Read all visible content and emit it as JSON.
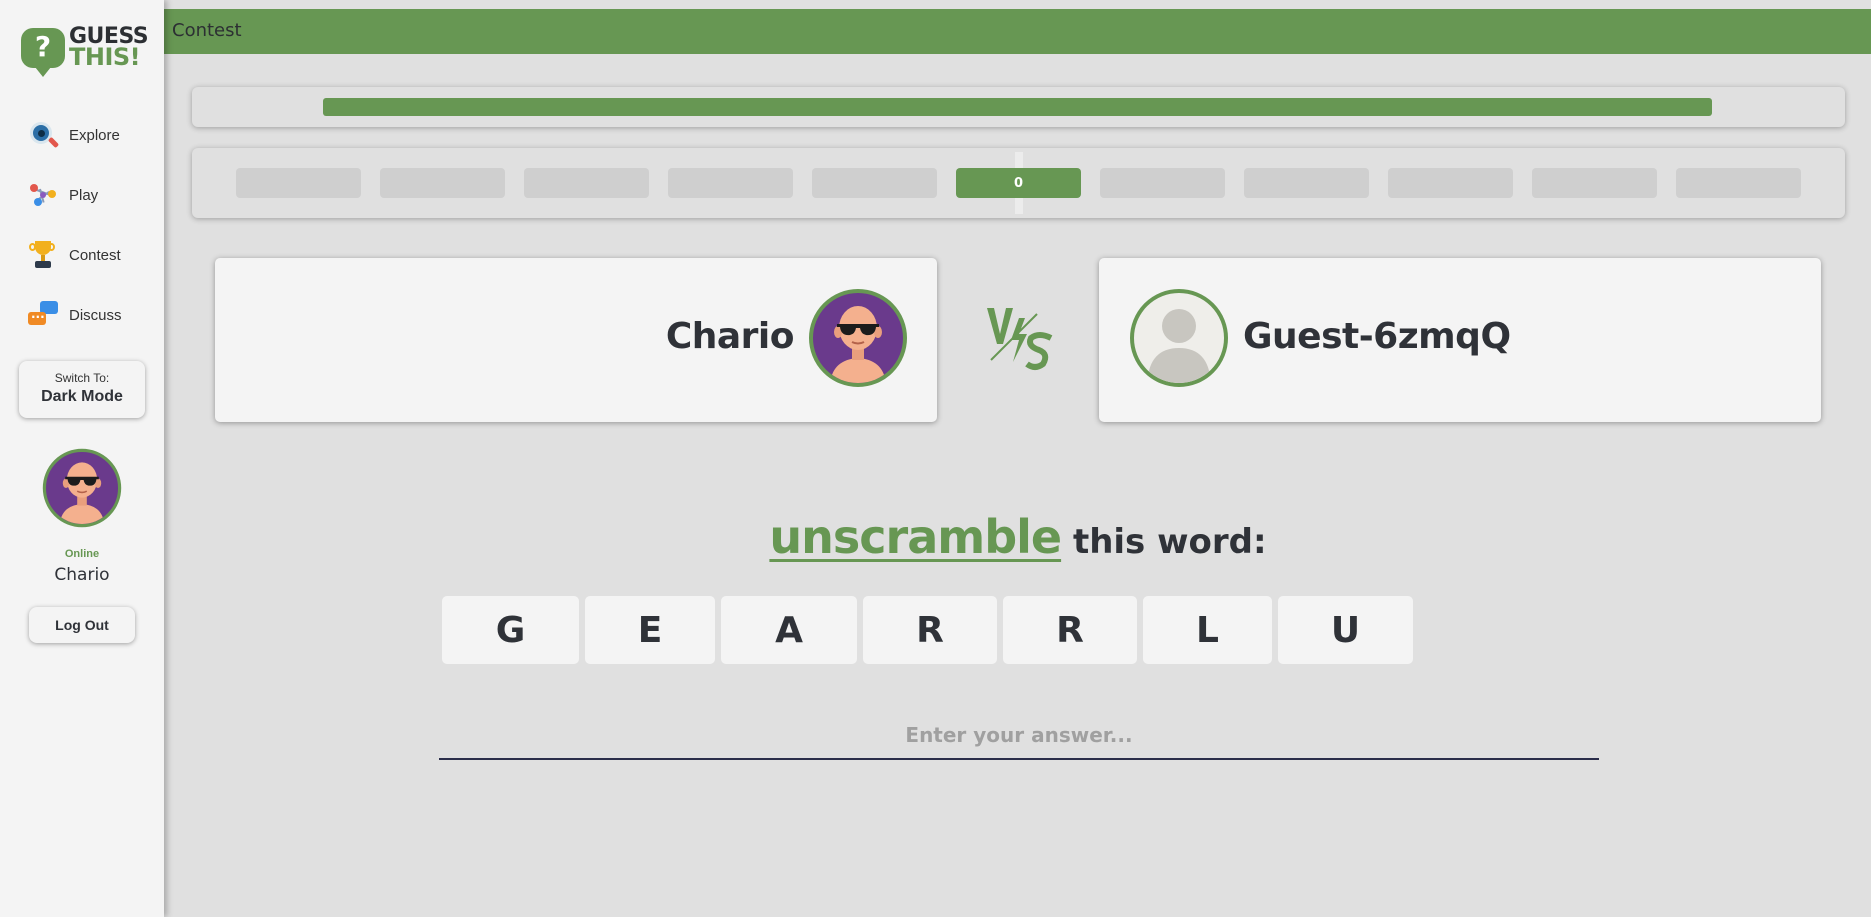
{
  "app": {
    "logo_line1": "GUESS",
    "logo_line2": "THIS!",
    "logo_symbol": "?"
  },
  "sidebar": {
    "items": [
      {
        "label": "Explore",
        "icon": "explore-icon"
      },
      {
        "label": "Play",
        "icon": "play-icon"
      },
      {
        "label": "Contest",
        "icon": "trophy-icon"
      },
      {
        "label": "Discuss",
        "icon": "chat-icon"
      }
    ],
    "mode_switch": {
      "caption": "Switch To:",
      "mode": "Dark Mode"
    },
    "user": {
      "status": "Online",
      "name": "Chario"
    },
    "logout_label": "Log Out"
  },
  "header": {
    "title": "Contest"
  },
  "progress": {
    "fill_fraction": 0.84
  },
  "rounds": {
    "items": [
      "",
      "",
      "",
      "",
      "",
      "0",
      "",
      "",
      "",
      "",
      ""
    ],
    "active_index": 5
  },
  "players": {
    "player1": {
      "name": "Chario"
    },
    "player2": {
      "name": "Guest-6zmqQ"
    }
  },
  "puzzle": {
    "highlight": "unscramble",
    "rest": "this word:",
    "letters": [
      "G",
      "E",
      "A",
      "R",
      "R",
      "L",
      "U"
    ]
  },
  "answer": {
    "placeholder": "Enter your answer...",
    "value": ""
  },
  "colors": {
    "accent": "#679753",
    "text_dark": "#2f3238",
    "background": "#e0e0e0",
    "card": "#f4f4f4",
    "avatar_purple": "#6a3a8c"
  }
}
